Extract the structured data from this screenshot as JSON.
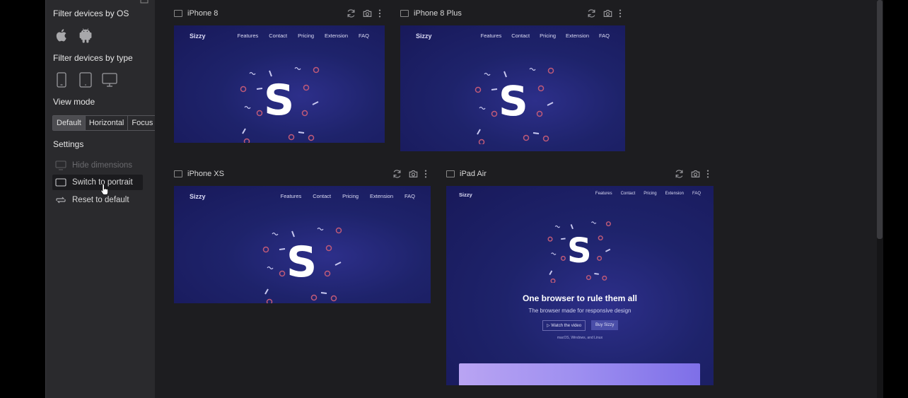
{
  "sidebar": {
    "filter_os_title": "Filter devices by OS",
    "filter_type_title": "Filter devices by type",
    "view_mode_title": "View mode",
    "view_modes": [
      "Default",
      "Horizontal",
      "Focus"
    ],
    "active_view_mode": "Default",
    "settings_title": "Settings",
    "settings_items": [
      {
        "label": "Hide dimensions",
        "icon": "monitor-icon",
        "disabled": true
      },
      {
        "label": "Switch to portrait",
        "icon": "landscape-icon",
        "hovered": true
      },
      {
        "label": "Reset to default",
        "icon": "reset-icon"
      }
    ]
  },
  "devices": [
    {
      "name": "iPhone 8"
    },
    {
      "name": "iPhone 8 Plus"
    },
    {
      "name": "iPhone XS"
    },
    {
      "name": "iPad Air"
    }
  ],
  "site": {
    "brand": "Sizzy",
    "nav": [
      "Features",
      "Contact",
      "Pricing",
      "Extension",
      "FAQ"
    ],
    "logo_letter": "S",
    "hero_title": "One browser to rule them all",
    "hero_subtitle": "The browser made for responsive design",
    "cta_watch": "▷ Watch the video",
    "cta_buy": "Buy Sizzy",
    "platforms": "macOS, Windows, and Linux"
  },
  "colors": {
    "sidebar_bg": "#2a2a2d",
    "main_bg": "#1d1d20",
    "site_bg": "#1e236b",
    "confetti": "#c05a78",
    "card_gradient_start": "#b9a4f3"
  }
}
